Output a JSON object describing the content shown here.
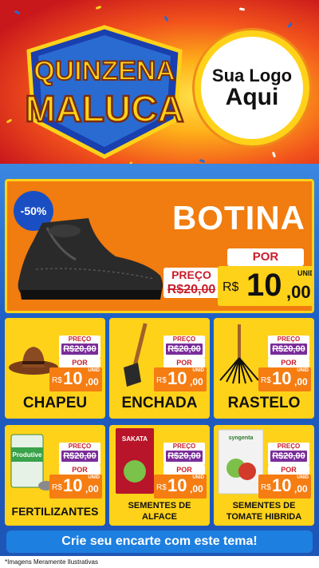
{
  "header": {
    "campaign_title_line1": "QUINZENA",
    "campaign_title_line2": "MALUCA",
    "logo_line1": "Sua Logo",
    "logo_line2": "Aqui"
  },
  "featured": {
    "discount_badge": "-50%",
    "name": "BOTINA",
    "preco_label": "PREÇO",
    "old_price": "R$20,00",
    "por_label": "POR",
    "currency": "R$",
    "price_int": "10",
    "price_dec": ",00",
    "unit_label": "UNID"
  },
  "products": [
    {
      "name": "CHAPEU",
      "preco_label": "PREÇO",
      "old_price": "R$20,00",
      "por_label": "POR",
      "currency": "R$",
      "price_int": "10",
      "price_dec": ",00",
      "unit_label": "UNID"
    },
    {
      "name": "ENCHADA",
      "preco_label": "PREÇO",
      "old_price": "R$20,00",
      "por_label": "POR",
      "currency": "R$",
      "price_int": "10",
      "price_dec": ",00",
      "unit_label": "UNID"
    },
    {
      "name": "RASTELO",
      "preco_label": "PREÇO",
      "old_price": "R$20,00",
      "por_label": "POR",
      "currency": "R$",
      "price_int": "10",
      "price_dec": ",00",
      "unit_label": "UNID"
    },
    {
      "name": "FERTILIZANTES",
      "preco_label": "PREÇO",
      "old_price": "R$20,00",
      "por_label": "POR",
      "currency": "R$",
      "price_int": "10",
      "price_dec": ",00",
      "unit_label": "UNID",
      "package_text": "Produtive"
    },
    {
      "name_line1": "SEMENTES DE",
      "name_line2": "ALFACE",
      "preco_label": "PREÇO",
      "old_price": "R$20,00",
      "por_label": "POR",
      "currency": "R$",
      "price_int": "10",
      "price_dec": ",00",
      "unit_label": "UNID",
      "package_text": "SAKATA"
    },
    {
      "name_line1": "SEMENTES DE",
      "name_line2": "TOMATE HIBRIDA",
      "preco_label": "PREÇO",
      "old_price": "R$20,00",
      "por_label": "POR",
      "currency": "R$",
      "price_int": "10",
      "price_dec": ",00",
      "unit_label": "UNID",
      "package_text": "syngenta"
    }
  ],
  "cta_label": "Crie seu encarte com este tema!",
  "footnote": "*Imagens Meramente Ilustrativas",
  "colors": {
    "card_yellow": "#ffd21a",
    "price_orange": "#f57d12",
    "featured_orange": "#f17c0f",
    "accent_red": "#c81e2a",
    "strike_purple": "#7a2d9a",
    "brand_blue": "#1b4fb5"
  }
}
